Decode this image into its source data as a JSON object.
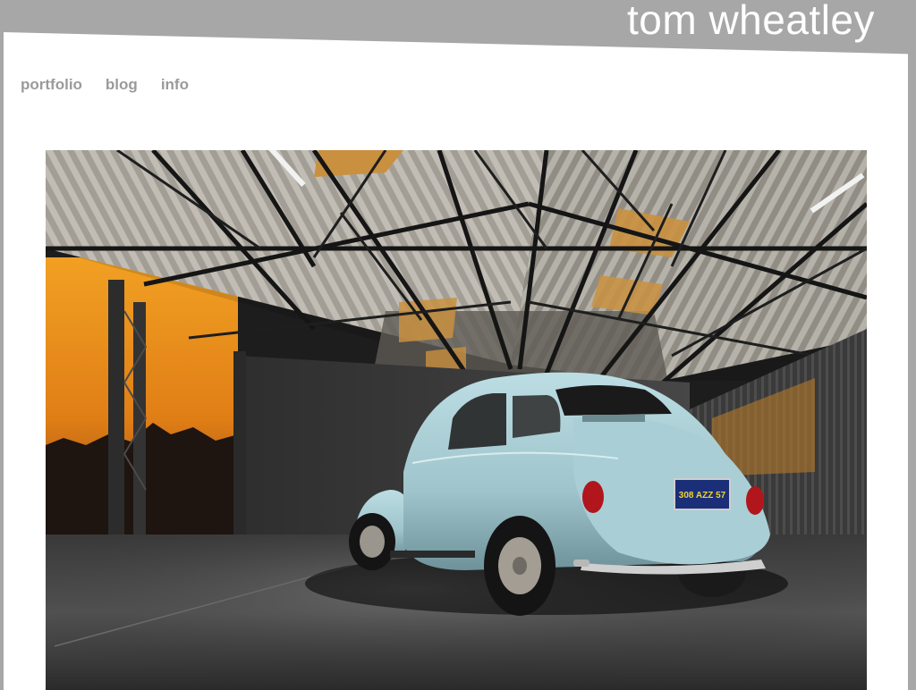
{
  "site": {
    "title": "tom wheatley"
  },
  "nav": {
    "items": [
      {
        "label": "portfolio"
      },
      {
        "label": "blog"
      },
      {
        "label": "info"
      }
    ]
  },
  "hero": {
    "plate_text": "308 AZZ 57",
    "colors": {
      "background_gray": "#a7a7a7",
      "nav_text": "#9a9a9a",
      "car_body": "#9fc4cc",
      "sky_orange": "#e7931d"
    }
  }
}
